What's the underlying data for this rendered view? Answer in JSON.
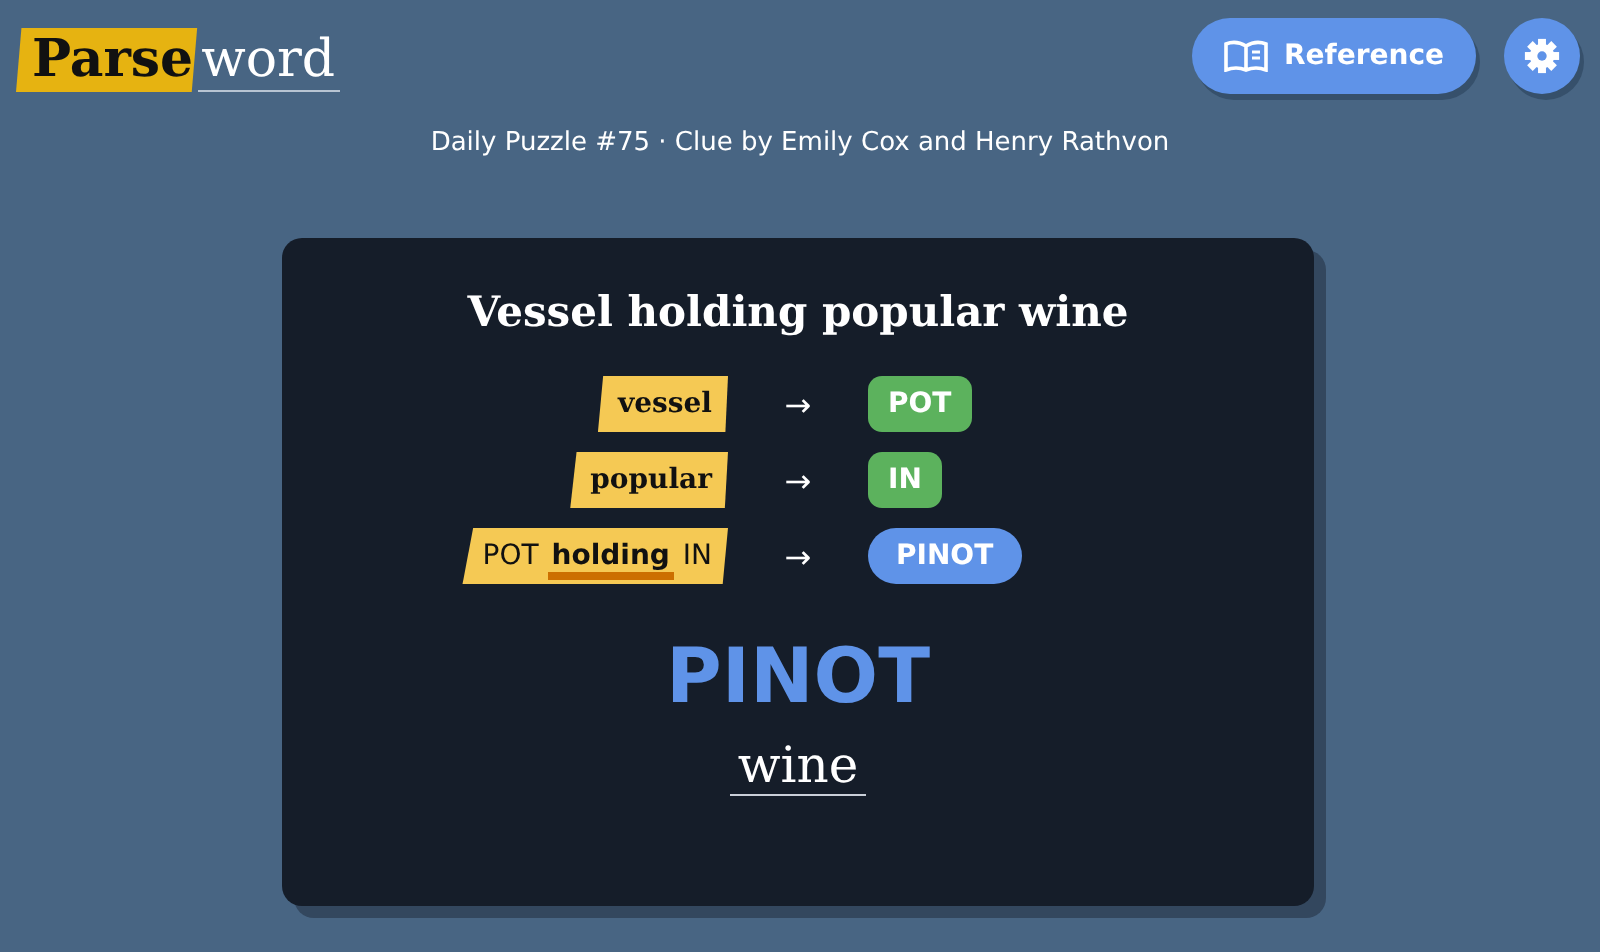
{
  "logo": {
    "highlight": "Parse",
    "rest": "word"
  },
  "header_buttons": {
    "reference": "Reference"
  },
  "subtitle": "Daily Puzzle #75 · Clue by Emily Cox and Henry Rathvon",
  "clue": "Vessel holding popular wine",
  "steps": [
    {
      "parts": [
        {
          "text": "vessel",
          "kind": "word"
        }
      ],
      "arrow": "→",
      "result": {
        "text": "POT",
        "kind": "part"
      }
    },
    {
      "parts": [
        {
          "text": "popular",
          "kind": "word"
        }
      ],
      "arrow": "→",
      "result": {
        "text": "IN",
        "kind": "part"
      }
    },
    {
      "parts": [
        {
          "text": "POT",
          "kind": "piece"
        },
        {
          "text": "holding",
          "kind": "indicator"
        },
        {
          "text": "IN",
          "kind": "piece"
        }
      ],
      "arrow": "→",
      "result": {
        "text": "PINOT",
        "kind": "answer"
      }
    }
  ],
  "answer": "PINOT",
  "definition": "wine"
}
